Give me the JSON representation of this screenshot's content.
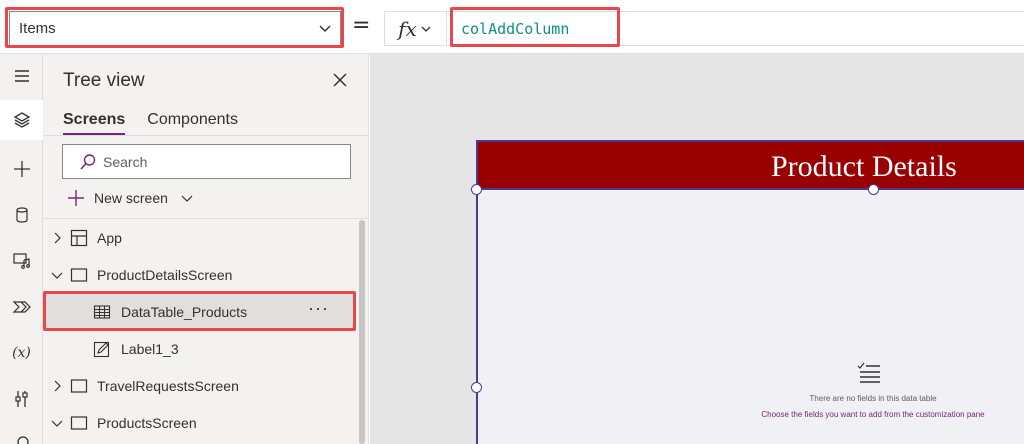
{
  "formula_bar": {
    "property": "Items",
    "equals": "=",
    "fx": "fx",
    "formula": "colAddColumn"
  },
  "rail": {
    "items": [
      {
        "icon": "hamburger-menu-icon"
      },
      {
        "icon": "layers-icon",
        "active": true
      },
      {
        "icon": "plus-icon"
      },
      {
        "icon": "database-icon"
      },
      {
        "icon": "media-icon"
      },
      {
        "icon": "power-automate-icon"
      },
      {
        "icon": "variables-icon",
        "text": "(x)"
      },
      {
        "icon": "advanced-tools-icon"
      },
      {
        "icon": "search-icon"
      }
    ]
  },
  "tree_view": {
    "title": "Tree view",
    "tabs": [
      {
        "label": "Screens",
        "active": true
      },
      {
        "label": "Components",
        "active": false
      }
    ],
    "search_placeholder": "Search",
    "new_screen": "New screen",
    "nodes": [
      {
        "label": "App",
        "icon": "app-icon",
        "expander": "chevron-right",
        "level": 0
      },
      {
        "label": "ProductDetailsScreen",
        "icon": "screen-icon",
        "expander": "chevron-down",
        "level": 0
      },
      {
        "label": "DataTable_Products",
        "icon": "data-table-icon",
        "level": 1,
        "selected": true,
        "more": "···"
      },
      {
        "label": "Label1_3",
        "icon": "label-edit-icon",
        "level": 1
      },
      {
        "label": "TravelRequestsScreen",
        "icon": "screen-icon",
        "expander": "chevron-right",
        "level": 0
      },
      {
        "label": "ProductsScreen",
        "icon": "screen-icon",
        "expander": "chevron-down",
        "level": 0
      }
    ]
  },
  "canvas": {
    "header_title": "Product Details",
    "empty_message": "There are no fields in this data table",
    "empty_hint": "Choose the fields you want to add from the customization pane"
  },
  "colors": {
    "accent": "#742774",
    "header_bg": "#990000",
    "formula_text": "#0e8f8a",
    "highlight": "#e8474c",
    "selection": "#4b3a8f"
  }
}
